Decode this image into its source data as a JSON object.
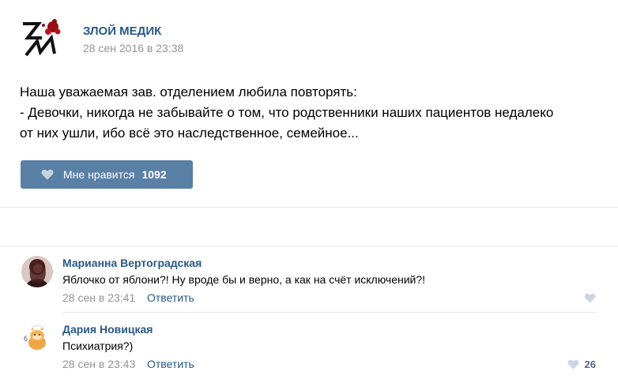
{
  "post": {
    "author": "ЗЛОЙ МЕДИК",
    "date": "28 сен 2016 в 23:38",
    "text_lines": [
      "Наша уважаемая зав. отделением любила повторять:",
      "- Девочки, никогда не забывайте о том, что родственники наших пациентов недалеко",
      "от них ушли, ибо всё это наследственное, семейное..."
    ],
    "like_label": "Мне нравится",
    "like_count": "1092",
    "logo_text": "ZM"
  },
  "comments": [
    {
      "author": "Марианна Вертоградская",
      "text": "Яблочко от яблони?! Ну вроде бы и верно, а как на счёт исключений?!",
      "date": "28 сен в 23:41",
      "reply_label": "Ответить",
      "likes": ""
    },
    {
      "author": "Дария Новицкая",
      "text": "Психиатрия?)",
      "date": "28 сен в 23:43",
      "reply_label": "Ответить",
      "likes": "26"
    }
  ],
  "colors": {
    "link": "#2a5885",
    "button": "#5b80a6",
    "meta": "#939393",
    "like_icon": "#6b8eb5"
  },
  "icons": {
    "like": "heart-icon",
    "comment_like": "heart-icon"
  }
}
